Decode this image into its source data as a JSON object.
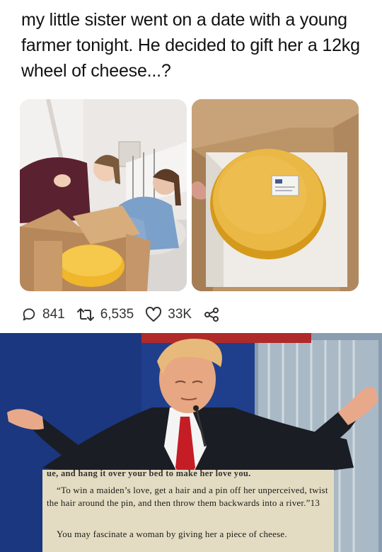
{
  "tweet": {
    "text": "my little sister went on a date with a young farmer tonight. He decided to gift her a 12kg wheel of cheese...?"
  },
  "actions": {
    "replies": "841",
    "retweets": "6,535",
    "likes": "33K"
  },
  "clipping": {
    "top_line": "ue, and hang it over your bed to make her love you.",
    "quote": "“To win a maiden’s love, get a hair and a pin off her unperceived, twist the hair around the pin, and then throw them backwards into a river.”13",
    "ending": "You may fascinate a woman by giving her a piece of cheese."
  },
  "colors": {
    "cheese": "#e8b63a",
    "box": "#c9a477",
    "meme_bg": "#1d3f8f",
    "suit": "#1b1d24",
    "tie": "#c41d26",
    "paper": "#e4dcc2"
  }
}
